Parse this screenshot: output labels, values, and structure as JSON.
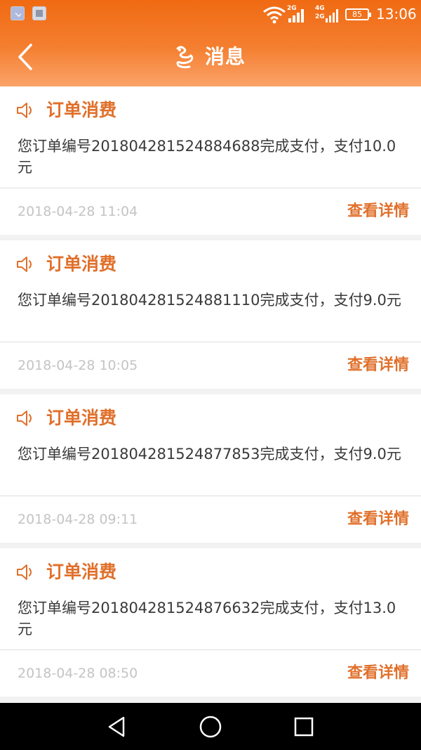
{
  "status_bar": {
    "net_top": "2G",
    "net_4g": "4G",
    "net_2g": "2G",
    "battery": "85",
    "time": "13:06"
  },
  "header": {
    "title": "消息",
    "back_icon": "chevron-left-icon",
    "logo_icon": "dragon-logo-icon"
  },
  "messages": [
    {
      "title": "订单消费",
      "body": "您订单编号201804281524884688完成支付，支付10.0元",
      "time": "2018-04-28 11:04",
      "detail_label": "查看详情"
    },
    {
      "title": "订单消费",
      "body": "您订单编号201804281524881110完成支付，支付9.0元",
      "time": "2018-04-28 10:05",
      "detail_label": "查看详情"
    },
    {
      "title": "订单消费",
      "body": "您订单编号201804281524877853完成支付，支付9.0元",
      "time": "2018-04-28 09:11",
      "detail_label": "查看详情"
    },
    {
      "title": "订单消费",
      "body": "您订单编号201804281524876632完成支付，支付13.0元",
      "time": "2018-04-28 08:50",
      "detail_label": "查看详情"
    }
  ],
  "nav_bar": {
    "back": "triangle-back-icon",
    "home": "circle-home-icon",
    "recents": "square-recents-icon"
  },
  "colors": {
    "accent": "#e0702b",
    "header_top": "#f06a12",
    "header_bottom": "#fba36a",
    "timestamp": "#c4c4c4",
    "body_text": "#3a3a3a"
  }
}
